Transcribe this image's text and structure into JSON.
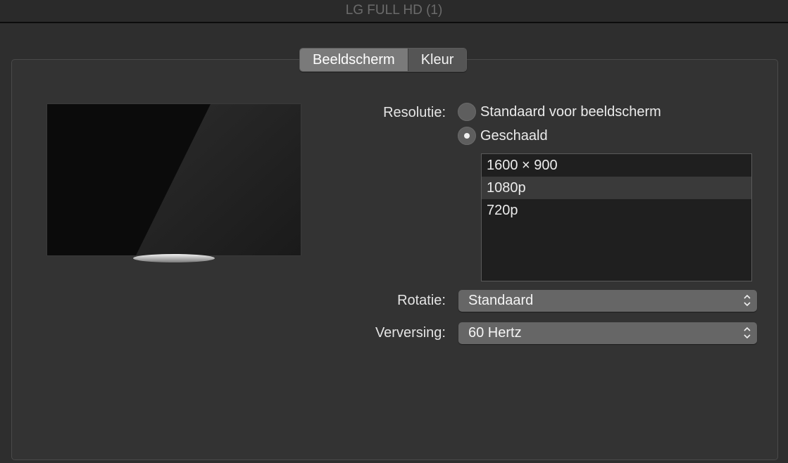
{
  "window": {
    "title": "LG FULL HD (1)"
  },
  "tabs": [
    {
      "label": "Beeldscherm",
      "active": true
    },
    {
      "label": "Kleur",
      "active": false
    }
  ],
  "resolution": {
    "label": "Resolutie:",
    "options": [
      {
        "label": "Standaard voor beeldscherm",
        "checked": false
      },
      {
        "label": "Geschaald",
        "checked": true
      }
    ],
    "list": [
      "1600 × 900",
      "1080p",
      "720p"
    ],
    "selected": "1080p"
  },
  "rotation": {
    "label": "Rotatie:",
    "value": "Standaard"
  },
  "refresh": {
    "label": "Verversing:",
    "value": "60 Hertz"
  },
  "icons": {
    "display_preview": "monitor-preview-icon",
    "select_arrows": "up-down-chevron-icon"
  },
  "colors": {
    "background": "#2e2e2e",
    "panel": "#333333",
    "tab_active": "#7a7a7a",
    "select": "#666666",
    "list_bg": "#1f1f1f"
  }
}
